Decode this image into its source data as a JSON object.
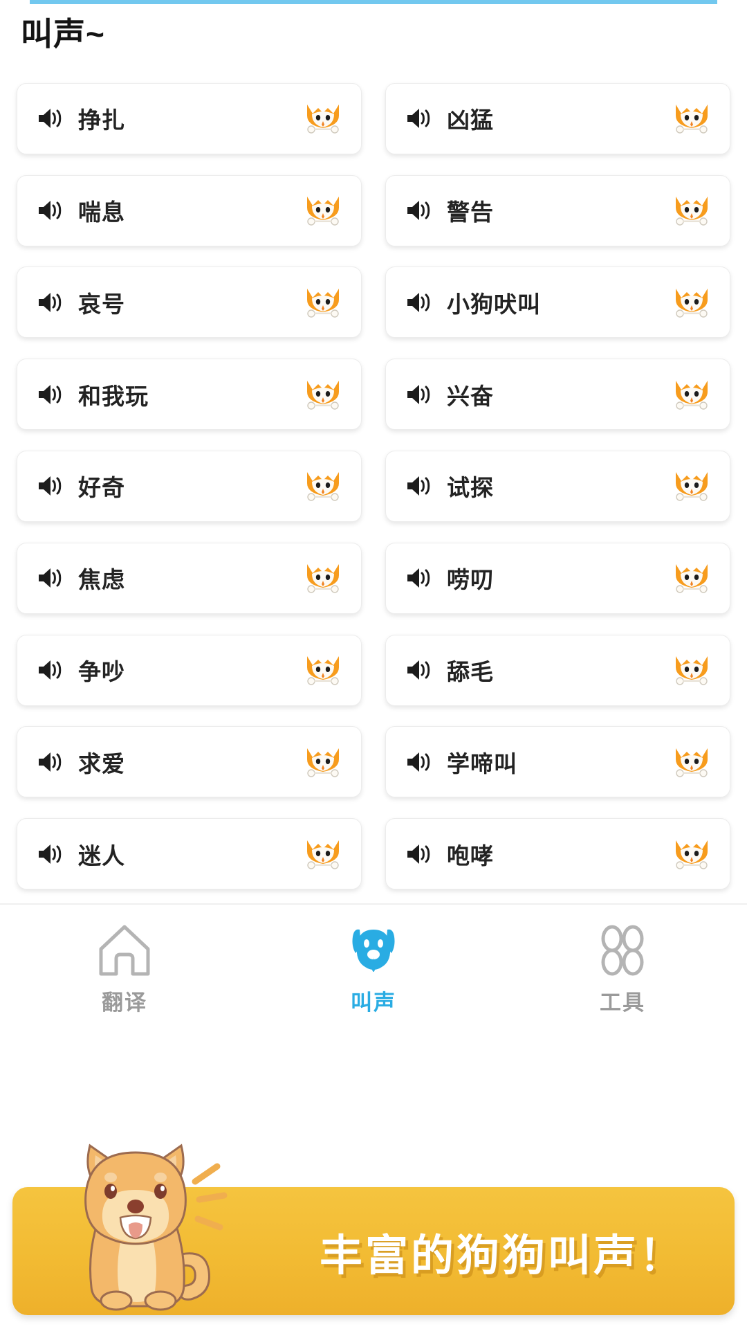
{
  "page_title": "叫声~",
  "colors": {
    "accent_blue": "#29ace3",
    "banner_orange": "#f2bb33",
    "dog_orange": "#f5a623",
    "card_bg": "#ffffff",
    "text_dark": "#232323",
    "tab_inactive": "#9a9a9a"
  },
  "sounds": [
    {
      "left": {
        "label": "挣扎",
        "speaker_icon": "speaker-icon",
        "dog_icon": "dog-face-icon"
      },
      "right": {
        "label": "凶猛",
        "speaker_icon": "speaker-icon",
        "dog_icon": "dog-face-icon"
      }
    },
    {
      "left": {
        "label": "喘息",
        "speaker_icon": "speaker-icon",
        "dog_icon": "dog-face-icon"
      },
      "right": {
        "label": "警告",
        "speaker_icon": "speaker-icon",
        "dog_icon": "dog-face-icon"
      }
    },
    {
      "left": {
        "label": "哀号",
        "speaker_icon": "speaker-icon",
        "dog_icon": "dog-face-icon"
      },
      "right": {
        "label": "小狗吠叫",
        "speaker_icon": "speaker-icon",
        "dog_icon": "dog-face-icon"
      }
    },
    {
      "left": {
        "label": "和我玩",
        "speaker_icon": "speaker-icon",
        "dog_icon": "dog-face-icon"
      },
      "right": {
        "label": "兴奋",
        "speaker_icon": "speaker-icon",
        "dog_icon": "dog-face-icon"
      }
    },
    {
      "left": {
        "label": "好奇",
        "speaker_icon": "speaker-icon",
        "dog_icon": "dog-face-icon"
      },
      "right": {
        "label": "试探",
        "speaker_icon": "speaker-icon",
        "dog_icon": "dog-face-icon"
      }
    },
    {
      "left": {
        "label": "焦虑",
        "speaker_icon": "speaker-icon",
        "dog_icon": "dog-face-icon"
      },
      "right": {
        "label": "唠叨",
        "speaker_icon": "speaker-icon",
        "dog_icon": "dog-face-icon"
      }
    },
    {
      "left": {
        "label": "争吵",
        "speaker_icon": "speaker-icon",
        "dog_icon": "dog-face-icon"
      },
      "right": {
        "label": "舔毛",
        "speaker_icon": "speaker-icon",
        "dog_icon": "dog-face-icon"
      }
    },
    {
      "left": {
        "label": "求爱",
        "speaker_icon": "speaker-icon",
        "dog_icon": "dog-face-icon"
      },
      "right": {
        "label": "学啼叫",
        "speaker_icon": "speaker-icon",
        "dog_icon": "dog-face-icon"
      }
    },
    {
      "left": {
        "label": "迷人",
        "speaker_icon": "speaker-icon",
        "dog_icon": "dog-face-icon"
      },
      "right": {
        "label": "咆哮",
        "speaker_icon": "speaker-icon",
        "dog_icon": "dog-face-icon"
      }
    }
  ],
  "tabbar": {
    "items": [
      {
        "label": "翻译",
        "icon": "home-icon",
        "active": false
      },
      {
        "label": "叫声",
        "icon": "dog-head-icon",
        "active": true
      },
      {
        "label": "工具",
        "icon": "grid-petals-icon",
        "active": false
      }
    ]
  },
  "banner": {
    "text": "丰富的狗狗叫声！",
    "mascot_icon": "shiba-inu-sitting-icon"
  }
}
